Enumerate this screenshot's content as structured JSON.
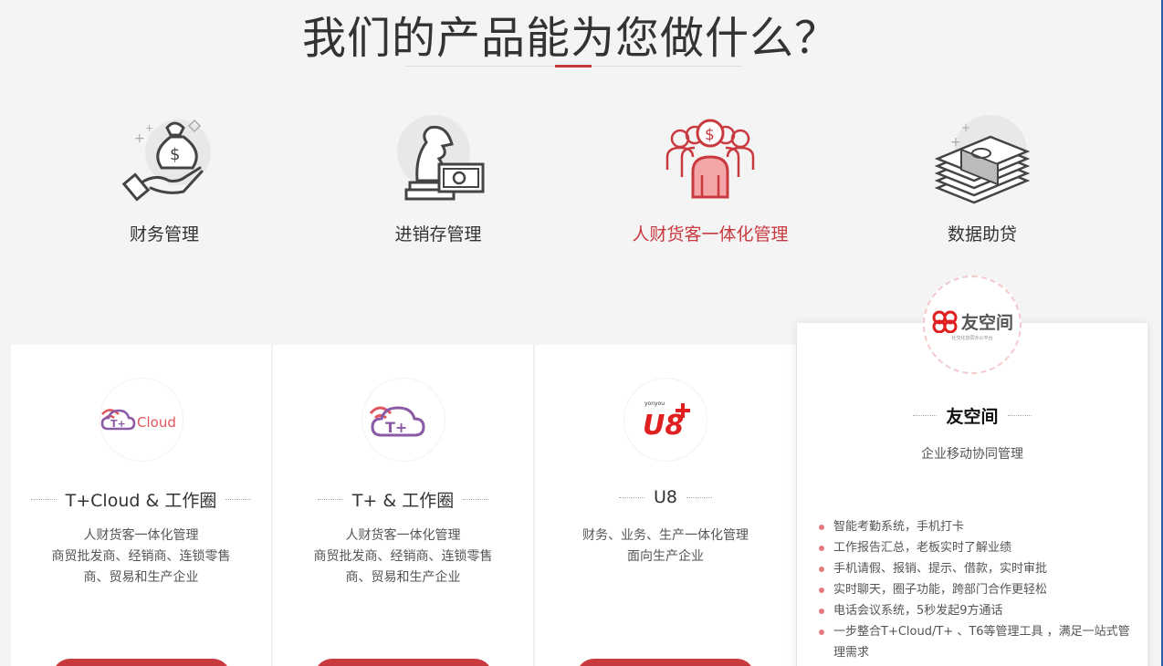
{
  "title": "我们的产品能为您做什么？",
  "colors": {
    "accent": "#c93a3f",
    "background": "#f5f4f5"
  },
  "features": [
    {
      "label": "财务管理",
      "icon": "money-bag-hand-icon",
      "active": false
    },
    {
      "label": "进销存管理",
      "icon": "chess-knight-cash-icon",
      "active": false
    },
    {
      "label": "人财货客一体化管理",
      "icon": "people-money-icon",
      "active": true
    },
    {
      "label": "数据助贷",
      "icon": "money-stack-icon",
      "active": false
    }
  ],
  "products": [
    {
      "logo_text": "Cloud",
      "title": "T+Cloud & 工作圈",
      "desc": [
        "人财货客一体化管理",
        "商贸批发商、经销商、连锁零售",
        "商、贸易和生产企业"
      ]
    },
    {
      "title": "T+ & 工作圈",
      "desc": [
        "人财货客一体化管理",
        "商贸批发商、经销商、连锁零售",
        "商、贸易和生产企业"
      ]
    },
    {
      "logo_small": "yonyou",
      "logo_text": "U8",
      "title": "U8",
      "desc": [
        "财务、业务、生产一体化管理",
        "面向生产企业"
      ]
    }
  ],
  "youkongjian": {
    "brand": "友空间",
    "brand_sub": "社交化协同办公平台",
    "title": "友空间",
    "desc": "企业移动协同管理",
    "features": [
      "智能考勤系统，手机打卡",
      "工作报告汇总，老板实时了解业绩",
      "手机请假、报销、提示、借款，实时审批",
      "实时聊天，圈子功能，跨部门合作更轻松",
      "电话会议系统，5秒发起9方通话",
      "一步整合T+Cloud/T+ 、T6等管理工具 ，满足一站式管理需求"
    ]
  }
}
